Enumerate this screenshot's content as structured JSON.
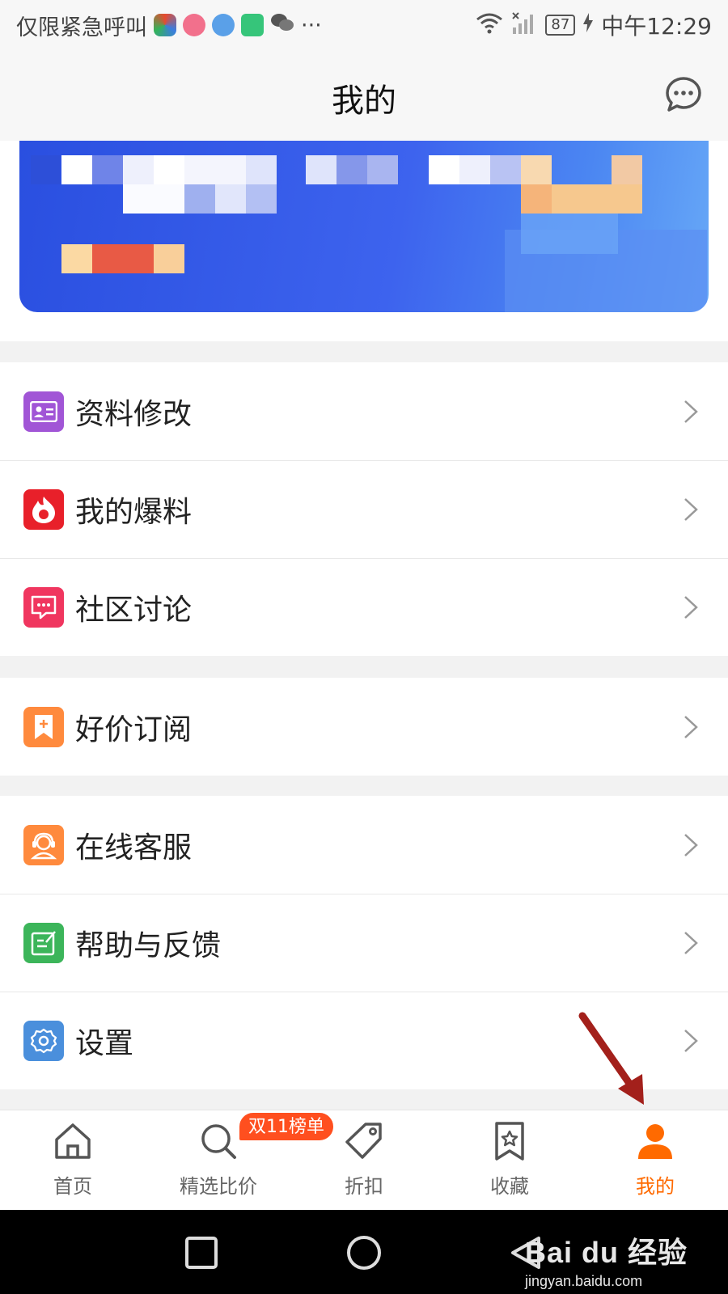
{
  "status_bar": {
    "carrier_text": "仅限紧急呼叫",
    "battery": "87",
    "time": "中午12:29",
    "more": "···"
  },
  "header": {
    "title": "我的",
    "message_icon": "chat-bubble-icon"
  },
  "menu_groups": [
    {
      "items": [
        {
          "label": "资料修改",
          "icon": "id-card-icon",
          "color": "#a155d6"
        },
        {
          "label": "我的爆料",
          "icon": "flame-icon",
          "color": "#e8202a"
        },
        {
          "label": "社区讨论",
          "icon": "chat-icon",
          "color": "#f0365f"
        }
      ]
    },
    {
      "items": [
        {
          "label": "好价订阅",
          "icon": "bookmark-plus-icon",
          "color": "#ff8a3d"
        }
      ]
    },
    {
      "items": [
        {
          "label": "在线客服",
          "icon": "headset-agent-icon",
          "color": "#ff8a3d"
        },
        {
          "label": "帮助与反馈",
          "icon": "edit-note-icon",
          "color": "#3cb55a"
        },
        {
          "label": "设置",
          "icon": "gear-icon",
          "color": "#4a8fdc"
        }
      ]
    }
  ],
  "tabbar": {
    "tabs": [
      {
        "label": "首页",
        "icon": "home-icon"
      },
      {
        "label": "精选比价",
        "icon": "search-icon"
      },
      {
        "label": "折扣",
        "icon": "tag-icon"
      },
      {
        "label": "收藏",
        "icon": "star-bookmark-icon"
      },
      {
        "label": "我的",
        "icon": "person-icon",
        "active": true
      }
    ],
    "badge": "双11榜单"
  },
  "watermark": {
    "logo": "Bai du 经验",
    "url": "jingyan.baidu.com"
  },
  "colors": {
    "accent": "#ff6a00",
    "badge": "#ff4f1f",
    "banner": "#3d63ee"
  }
}
